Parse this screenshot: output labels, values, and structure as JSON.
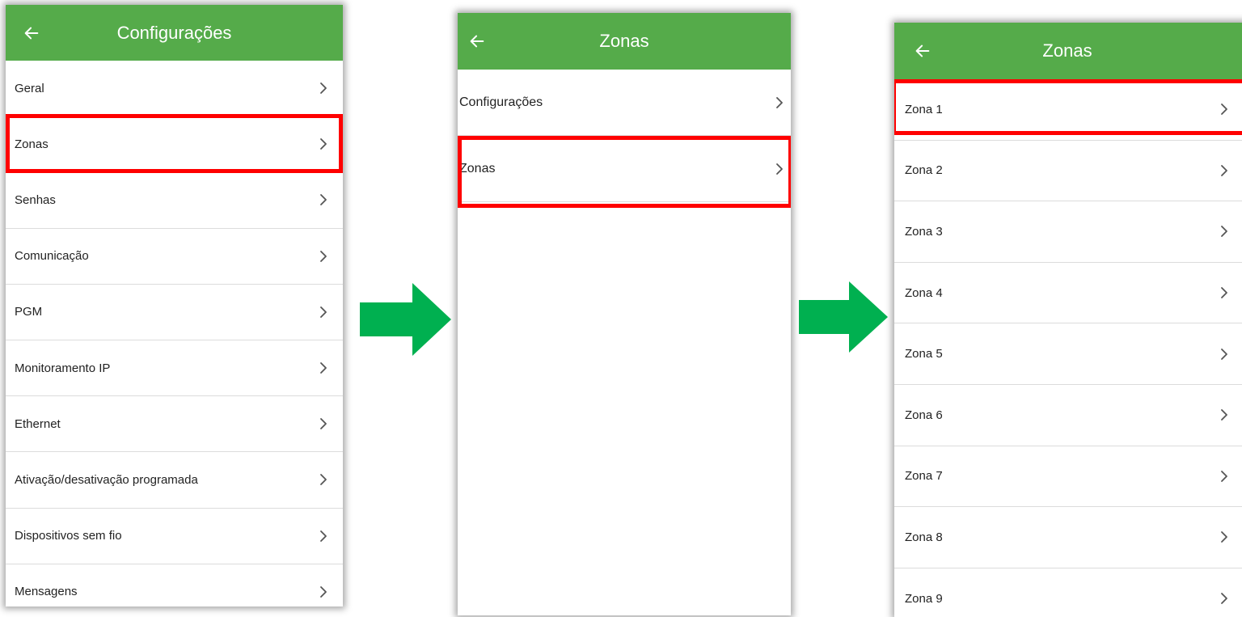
{
  "colors": {
    "appbar": "#55ab4a",
    "highlight": "#ff0000",
    "flow_arrow": "#00b050"
  },
  "screen1": {
    "title": "Configurações",
    "back_icon": "arrow-left-icon",
    "items": [
      {
        "label": "Geral"
      },
      {
        "label": "Zonas"
      },
      {
        "label": "Senhas"
      },
      {
        "label": "Comunicação"
      },
      {
        "label": "PGM"
      },
      {
        "label": "Monitoramento IP"
      },
      {
        "label": "Ethernet"
      },
      {
        "label": "Ativação/desativação programada"
      },
      {
        "label": "Dispositivos sem fio"
      },
      {
        "label": "Mensagens"
      }
    ],
    "highlighted_item": "Zonas"
  },
  "screen2": {
    "title": "Zonas",
    "back_icon": "arrow-left-icon",
    "items": [
      {
        "label": "Configurações"
      },
      {
        "label": "Zonas"
      }
    ],
    "highlighted_item": "Zonas"
  },
  "screen3": {
    "title": "Zonas",
    "back_icon": "arrow-left-icon",
    "items": [
      {
        "label": "Zona 1"
      },
      {
        "label": "Zona 2"
      },
      {
        "label": "Zona 3"
      },
      {
        "label": "Zona 4"
      },
      {
        "label": "Zona 5"
      },
      {
        "label": "Zona 6"
      },
      {
        "label": "Zona 7"
      },
      {
        "label": "Zona 8"
      },
      {
        "label": "Zona 9"
      }
    ],
    "highlighted_item": "Zona 1"
  },
  "flow_arrow_icon": "arrow-right-icon",
  "chevron_icon": "chevron-right-icon"
}
